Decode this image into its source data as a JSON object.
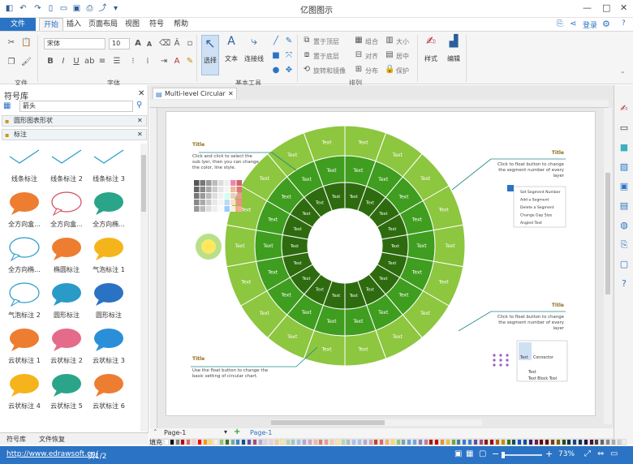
{
  "app": {
    "title": "亿图图示"
  },
  "menu": {
    "file": "文件",
    "tabs": [
      "开始",
      "插入",
      "页面布局",
      "视图",
      "符号",
      "帮助"
    ],
    "login": "登录"
  },
  "ribbon": {
    "groups": {
      "file": "文件",
      "font": "字体",
      "basic_tools": "基本工具",
      "arrange": "排列"
    },
    "font_name": "宋体",
    "font_size": "10",
    "tools": {
      "select": "选择",
      "text": "文本",
      "connector": "连接线",
      "style": "样式",
      "edit": "编辑"
    },
    "arrange_items": [
      "置于顶层",
      "置于底层",
      "旋转和镜像",
      "组合",
      "对齐",
      "分布",
      "大小",
      "居中",
      "保护"
    ]
  },
  "library": {
    "title": "符号库",
    "search_value": "箭头",
    "sections": [
      "圆形图表形状",
      "标注"
    ],
    "shapes": [
      "线条标注",
      "线条标注 2",
      "线条标注 3",
      "全方向盒...",
      "全方向盒...",
      "全方向椭...",
      "全方向椭...",
      "椭圆标注",
      "气泡标注 1",
      "气泡标注 2",
      "圆形标注",
      "圆形标注",
      "云状标注 1",
      "云状标注 2",
      "云状标注 3",
      "云状标注 4",
      "云状标注 5",
      "云状标注 6"
    ],
    "bottom_tabs": [
      "符号库",
      "文件恢复"
    ]
  },
  "document": {
    "tab": "Multi-level Circular",
    "page_tab": "Page-1",
    "page_name": "Page-1"
  },
  "diagram": {
    "segment_text": "Text",
    "notes": [
      {
        "title": "Title",
        "body": "Click and click to select the sub lyer, then you can change the color, line style."
      },
      {
        "title": "Title",
        "body": "Click to float button to change the segment number of every layer"
      },
      {
        "title": "Title",
        "body": "Click to float button to change the segment number of every layer"
      },
      {
        "title": "Title",
        "body": "Use the float button to change the basic setting of circular chart."
      }
    ],
    "context_menu": [
      "Set Segment Number",
      "Add a Segment",
      "Delete a Segment",
      "Change Gap Size",
      "Angled Text"
    ],
    "float_menu": [
      "Text",
      "Connector",
      "Text",
      "Text Block Tool"
    ],
    "colors": {
      "outer": "#8dc63f",
      "middle": "#3f9d1f",
      "inner": "#2e6b0f",
      "line": "#1f8a8a"
    }
  },
  "palette_label": "填充",
  "status": {
    "url": "http://www.edrawsoft.cn/",
    "page": "页1/2",
    "zoom": "73%"
  }
}
